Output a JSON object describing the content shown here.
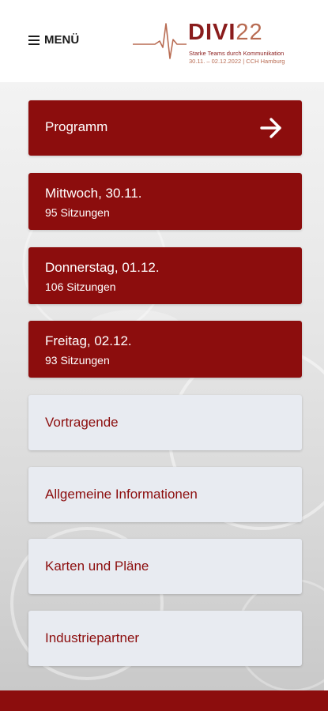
{
  "header": {
    "menu_label": "MENÜ",
    "logo": {
      "wordmark": "DIVI",
      "year": "22",
      "tagline": "Starke Teams durch Kommunikation",
      "dates": "30.11. – 02.12.2022 | CCH Hamburg"
    }
  },
  "nav": {
    "programm": {
      "title": "Programm",
      "icon": "arrow-right-icon"
    },
    "days": [
      {
        "title": "Mittwoch, 30.11.",
        "sessions": "95 Sitzungen"
      },
      {
        "title": "Donnerstag, 01.12.",
        "sessions": "106 Sitzungen"
      },
      {
        "title": "Freitag, 02.12.",
        "sessions": "93 Sitzungen"
      }
    ],
    "links": [
      {
        "title": "Vortragende"
      },
      {
        "title": "Allgemeine Informationen"
      },
      {
        "title": "Karten und Pläne"
      },
      {
        "title": "Industriepartner"
      }
    ]
  },
  "colors": {
    "brand_red": "#8c0d0d",
    "light_card": "#e8ebf1",
    "logo_accent": "#b86b52"
  }
}
